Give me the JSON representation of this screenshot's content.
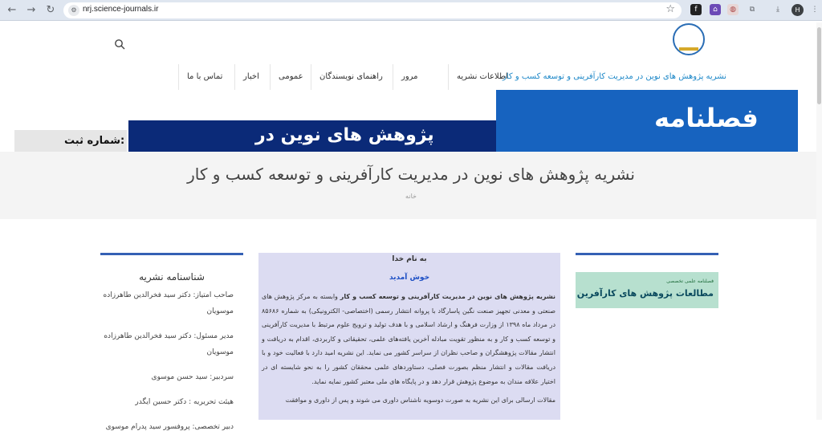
{
  "browser": {
    "url": "nrj.science-journals.ir",
    "avatar_letter": "H"
  },
  "site": {
    "nav": [
      {
        "label": "نشریه پژوهش های نوین در مدیریت کارآفرینی و توسعه کسب و کار",
        "active": true
      },
      {
        "label": "اطلاعات نشریه"
      },
      {
        "label": "مرور"
      },
      {
        "label": "راهنمای نویسندگان"
      },
      {
        "label": "عمومی"
      },
      {
        "label": "اخبار"
      },
      {
        "label": "تماس با ما"
      }
    ],
    "banner": {
      "text_blue": "فصلنامه",
      "text_dark": "پژوهش های نوین در",
      "text_gray": "شماره ثبت:"
    },
    "page_title": "نشریه پژوهش های نوین در مدیریت کارآفرینی و توسعه کسب و کار",
    "breadcrumb": "خانه"
  },
  "right_panel": {
    "img_line1": "فصلنامه علمی تخصصی",
    "img_line2": "مطالعات پژوهش های کارآفرین"
  },
  "welcome": {
    "heading": "به نام خدا",
    "subheading": "خوش آمدید",
    "intro_bold": "نشریه پژوهش های نوین در مدیریت کارآفرینی و توسعه کسب و کار",
    "intro_rest": " وابسته به مرکز پژوهش های صنعتی و معدنی تجهیز صنعت نگین پاسارگاد با پروانه انتشار رسمی (اختصاصی- الکترونیکی) به شماره ۸۵۶۸۶ در مرداد ماه ۱۳۹۸ از وزارت فرهنگ و ارشاد اسلامی و با هدف تولید و ترویج علوم مرتبط با مدیریت کارآفرینی و توسعه کسب و کار و به منظور تقویت مبادله آخرین یافته‌های علمی، تحقیقاتی و کاربردی، اقدام به دریافت و انتشار مقالات پژوهشگران و صاحب نظران از سراسر کشور می نماید. این نشریه امید دارد با فعالیت خود و با دریافت مقالات و انتشار منظم بصورت فصلی، دستاوردهای علمی محققان کشور را به نحو شایسته ای در اختیار علاقه مندان به موضوع پژوهش قرار دهد و در پایگاه های ملی معتبر کشور نمایه نماید.",
    "para2": "مقالات ارسالی برای این نشریه به صورت دوسویه ناشناس داوری می شوند و پس از داوری و موافقت"
  },
  "identity": {
    "heading": "شناسنامه نشریه",
    "items": [
      "صاحب امتیاز: دکتر سید فخرالدین طاهرزاده موسویان",
      "مدیر مسئول: دکتر سید فخرالدین طاهرزاده موسویان",
      "سردبیر: سید حسن موسوی",
      "هیئت تحریریه : دکتر حسین ایگدر",
      "دبیر تخصصی: پروفسور سید پدرام موسوی"
    ]
  }
}
